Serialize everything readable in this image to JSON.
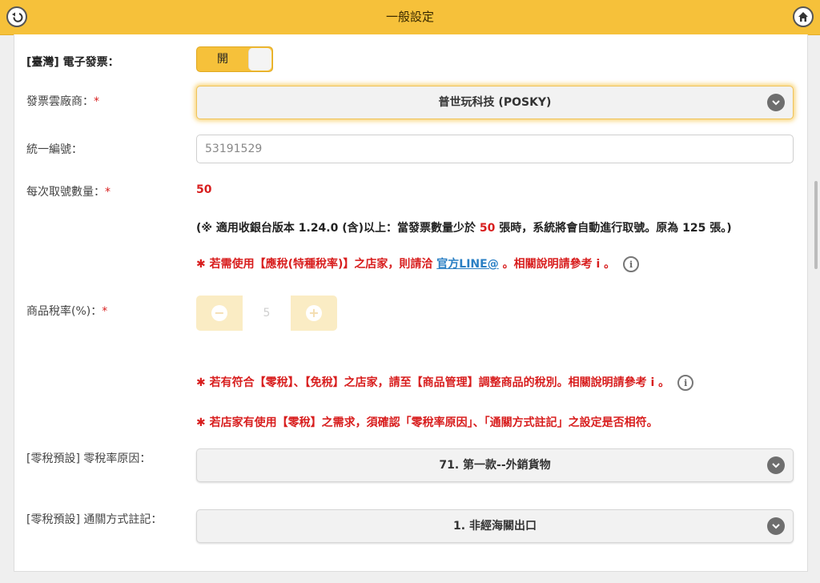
{
  "header": {
    "title": "一般設定"
  },
  "einvoice": {
    "label_bracket": "[臺灣]",
    "label_text": "電子發票：",
    "toggle_label": "開"
  },
  "vendor": {
    "label": "發票雲廠商：",
    "required": "*",
    "value": "普世玩科技 (POSKY)"
  },
  "tax_id": {
    "label": "統一編號：",
    "placeholder": "53191529"
  },
  "fetch_count": {
    "label": "每次取號數量：",
    "required": "*",
    "value": "50",
    "note_prefix": "(※ 適用收銀台版本 1.24.0 (含)以上：當發票數量少於 ",
    "note_number": "50",
    "note_suffix": " 張時，系統將會自動進行取號。原為 125 張。)"
  },
  "special_tax_note": {
    "prefix": "✱ 若需使用【應稅(特種稅率)】之店家，則請洽 ",
    "link": "官方LINE@",
    "suffix": " 。相關說明請參考 i 。"
  },
  "tax_rate": {
    "label": "商品稅率(%)：",
    "required": "*",
    "value": "5",
    "minus": "−",
    "plus": "+"
  },
  "zero_tax_note1": "✱ 若有符合【零稅】、【免稅】之店家，請至【商品管理】調整商品的稅別。相關說明請參考 i 。",
  "zero_tax_note2": "✱ 若店家有使用【零稅】之需求，須確認「零稅率原因」、「通關方式註記」之設定是否相符。",
  "zero_reason": {
    "label": "[零稅預設] 零稅率原因：",
    "value": "71. 第一款--外銷貨物"
  },
  "customs": {
    "label": "[零稅預設] 通關方式註記：",
    "value": "1. 非經海關出口"
  },
  "info_icon_glyph": "i",
  "colors": {
    "accent": "#f6c13a",
    "required_red": "#d81e1e",
    "link_blue": "#2a7fc4"
  }
}
